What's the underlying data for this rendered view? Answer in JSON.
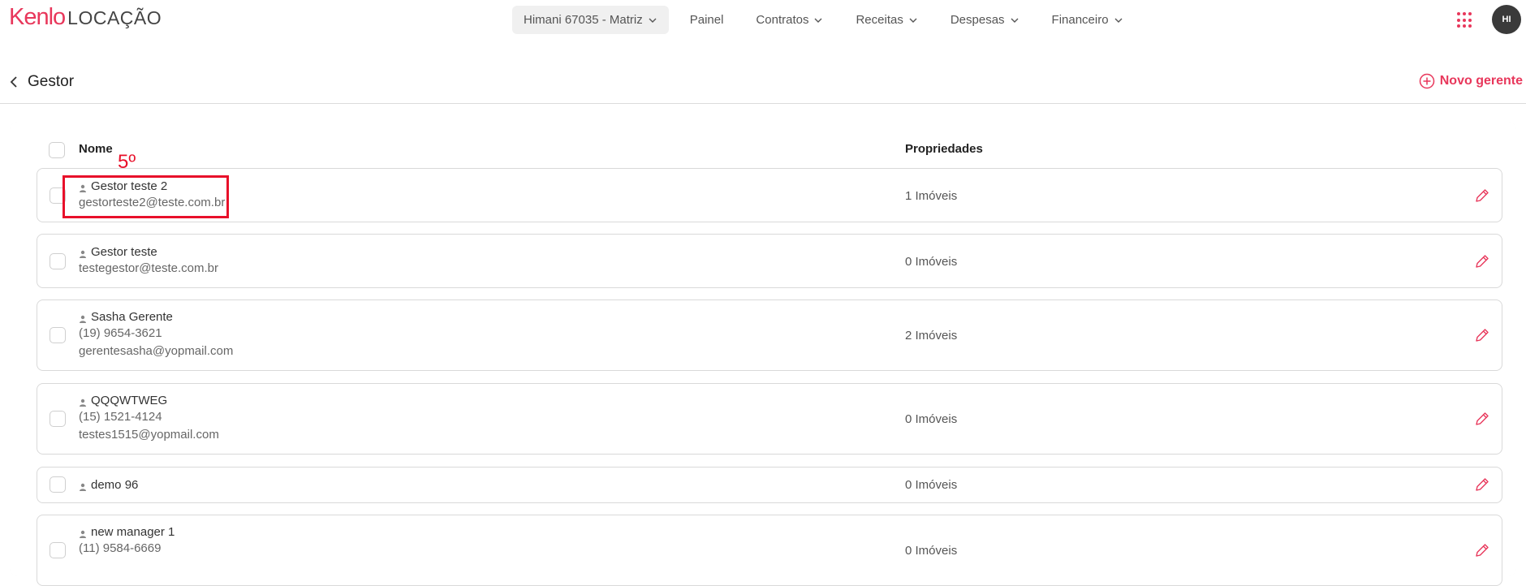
{
  "brand": {
    "name": "Kenlo",
    "product": "LOCAÇÃO",
    "accent": "#e8375b"
  },
  "nav": {
    "account": "Himani 67035 - Matriz",
    "items": [
      {
        "label": "Painel",
        "dropdown": false
      },
      {
        "label": "Contratos",
        "dropdown": true
      },
      {
        "label": "Receitas",
        "dropdown": true
      },
      {
        "label": "Despesas",
        "dropdown": true
      },
      {
        "label": "Financeiro",
        "dropdown": true
      }
    ],
    "avatar_initials": "HI"
  },
  "page": {
    "title": "Gestor",
    "new_button": "Novo gerente"
  },
  "table": {
    "headers": {
      "name": "Nome",
      "properties": "Propriedades"
    },
    "rows": [
      {
        "name": "Gestor teste 2",
        "phone": "",
        "email": "gestorteste2@teste.com.br",
        "properties": "1 Imóveis"
      },
      {
        "name": "Gestor teste",
        "phone": "",
        "email": "testegestor@teste.com.br",
        "properties": "0 Imóveis"
      },
      {
        "name": "Sasha Gerente",
        "phone": "(19) 9654-3621",
        "email": "gerentesasha@yopmail.com",
        "properties": "2 Imóveis"
      },
      {
        "name": "QQQWTWEG",
        "phone": "(15) 1521-4124",
        "email": "testes1515@yopmail.com",
        "properties": "0 Imóveis"
      },
      {
        "name": "demo 96",
        "phone": "",
        "email": "",
        "properties": "0 Imóveis"
      },
      {
        "name": "new manager 1",
        "phone": "(11) 9584-6669",
        "email": "",
        "properties": "0 Imóveis"
      }
    ]
  },
  "annotation": {
    "label": "5º",
    "color": "#e8102a"
  }
}
